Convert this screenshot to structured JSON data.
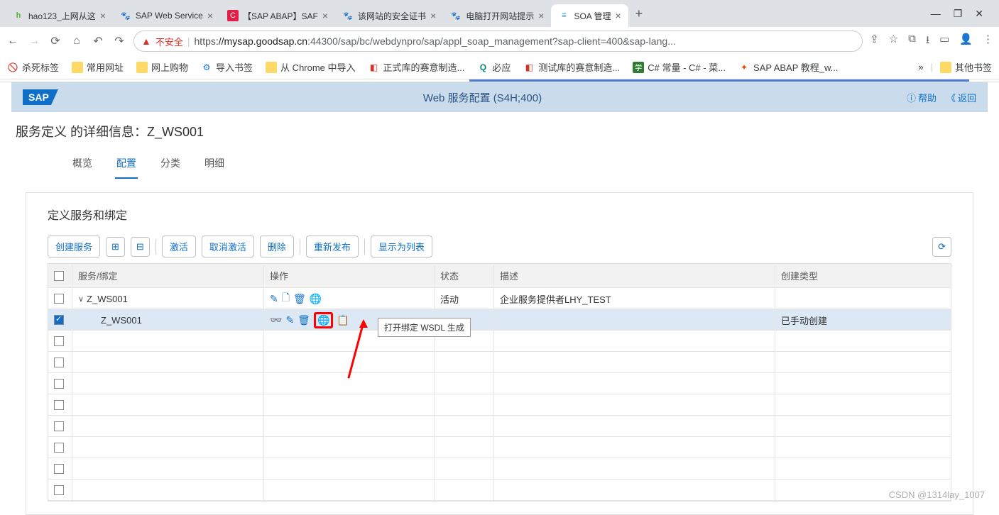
{
  "browser": {
    "tabs": [
      {
        "title": "hao123_上网从这",
        "favicon": "h",
        "fcolor": "#5fb336"
      },
      {
        "title": "SAP Web Service",
        "favicon": "🐾",
        "fcolor": "#2563eb"
      },
      {
        "title": "【SAP ABAP】SAF",
        "favicon": "C",
        "fcolor": "#fff",
        "fbg": "#e11d48"
      },
      {
        "title": "该网站的安全证书",
        "favicon": "🐾",
        "fcolor": "#2563eb"
      },
      {
        "title": "电脑打开网站提示",
        "favicon": "🐾",
        "fcolor": "#2563eb"
      },
      {
        "title": "SOA 管理",
        "favicon": "≡",
        "fcolor": "#2196f3",
        "active": true
      }
    ],
    "insecure_label": "不安全",
    "url_https": "https",
    "url_host": "://mysap.goodsap.cn",
    "url_path": ":44300/sap/bc/webdynpro/sap/appl_soap_management?sap-client=400&sap-lang...",
    "bookmarks": [
      {
        "label": "杀死标签",
        "icon": "🚫"
      },
      {
        "label": "常用网址",
        "icon": "📁"
      },
      {
        "label": "网上购物",
        "icon": "📁"
      },
      {
        "label": "导入书签",
        "icon": "⚙",
        "color": "#1a73e8"
      },
      {
        "label": "从 Chrome 中导入",
        "icon": "📁"
      },
      {
        "label": "正式库的赛意制造...",
        "icon": "◧",
        "color": "#d93025"
      },
      {
        "label": "必应",
        "icon": "Q",
        "color": "#008373"
      },
      {
        "label": "测试库的赛意制造...",
        "icon": "◧",
        "color": "#d93025"
      },
      {
        "label": "C# 常量 - C# - 菜...",
        "icon": "学",
        "color": "#fff",
        "bg": "#2e7d32"
      },
      {
        "label": "SAP ABAP 教程_w...",
        "icon": "✦",
        "color": "#e65100"
      }
    ],
    "other_bookmarks": "其他书签"
  },
  "header": {
    "title": "Web 服务配置 (S4H;400)",
    "help": "帮助",
    "back": "返回"
  },
  "page": {
    "title": "服务定义 的详细信息：Z_WS001",
    "tabs": [
      "概览",
      "配置",
      "分类",
      "明细"
    ],
    "active_tab": 1
  },
  "section": {
    "title": "定义服务和绑定",
    "buttons": {
      "create": "创建服务",
      "activate": "激活",
      "deactivate": "取消激活",
      "delete": "删除",
      "republish": "重新发布",
      "showlist": "显示为列表"
    }
  },
  "table": {
    "headers": [
      "服务/绑定",
      "操作",
      "状态",
      "描述",
      "创建类型"
    ],
    "rows": [
      {
        "name": "Z_WS001",
        "level": 0,
        "status": "活动",
        "desc": "企业服务提供者LHY_TEST",
        "created": "",
        "checked": false
      },
      {
        "name": "Z_WS001",
        "level": 1,
        "status": "",
        "desc": "",
        "created": "已手动创建",
        "checked": true
      }
    ],
    "tooltip": "打开绑定 WSDL 生成"
  },
  "watermark": "CSDN @1314lay_1007"
}
